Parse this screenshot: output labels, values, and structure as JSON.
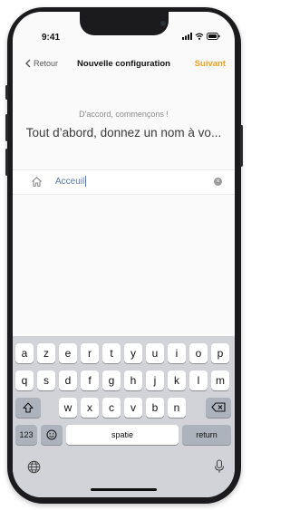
{
  "status": {
    "time": "9:41"
  },
  "nav": {
    "back_label": "Retour",
    "title": "Nouvelle configuration",
    "next_label": "Suivant"
  },
  "content": {
    "subtitle": "D'accord, commençons !",
    "headline": "Tout d’abord, donnez un nom à vo..."
  },
  "name_field": {
    "value": "Acceuil",
    "icon": "home-icon"
  },
  "keyboard": {
    "row1": [
      "a",
      "z",
      "e",
      "r",
      "t",
      "y",
      "u",
      "i",
      "o",
      "p"
    ],
    "row2": [
      "q",
      "s",
      "d",
      "f",
      "g",
      "h",
      "j",
      "k",
      "l",
      "m"
    ],
    "row3": [
      "w",
      "x",
      "c",
      "v",
      "b",
      "n"
    ],
    "numbers_label": "123",
    "space_label": "spatie",
    "return_label": "return"
  },
  "colors": {
    "accent": "#f0a020",
    "field_text": "#5a78b4",
    "caret": "#3b7cf5"
  }
}
